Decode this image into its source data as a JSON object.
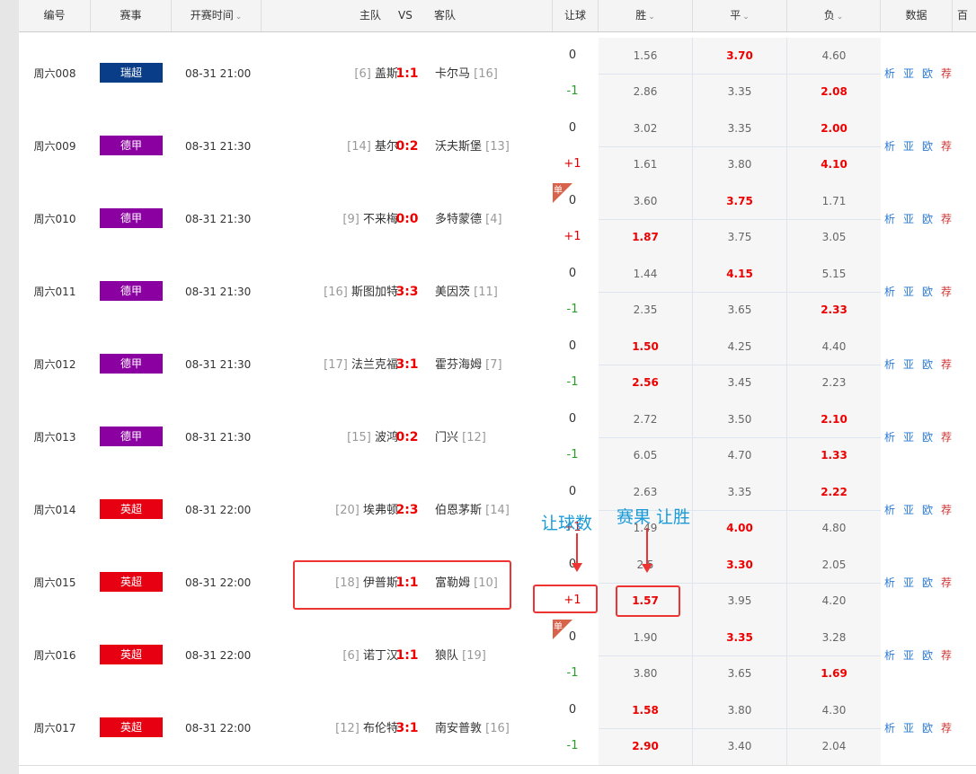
{
  "headers": {
    "num": "编号",
    "league": "赛事",
    "time": "开赛时间",
    "home": "主队",
    "vs": "VS",
    "away": "客队",
    "handicap": "让球",
    "win": "胜",
    "draw": "平",
    "lose": "负",
    "data": "数据",
    "extra": "百"
  },
  "colors": {
    "league_瑞超": "#0a3d87",
    "league_德甲": "#8b00a0",
    "league_英超": "#e60012",
    "red_text": "#e00000",
    "annotation": "#e33333",
    "annotation_text": "#1a9bd8"
  },
  "link_labels": [
    "析",
    "亚",
    "欧",
    "荐"
  ],
  "matches": [
    {
      "num": "周六008",
      "league": "瑞超",
      "league_color": "#0a3d87",
      "time": "08-31 21:00",
      "home_rank": "[6]",
      "home": "盖斯",
      "score": "1:1",
      "away": "卡尔马",
      "away_rank": "[16]",
      "hcp1": "0",
      "hcp2": "-1",
      "hcp2_color": "#2a9d2a",
      "dan": false,
      "odds1": [
        "1.56",
        "3.70",
        "4.60"
      ],
      "odds2": [
        "2.86",
        "3.35",
        "2.08"
      ],
      "red1": [
        false,
        true,
        false
      ],
      "red2": [
        false,
        false,
        true
      ]
    },
    {
      "num": "周六009",
      "league": "德甲",
      "league_color": "#8b00a0",
      "time": "08-31 21:30",
      "home_rank": "[14]",
      "home": "基尔",
      "score": "0:2",
      "away": "沃夫斯堡",
      "away_rank": "[13]",
      "hcp1": "0",
      "hcp2": "+1",
      "hcp2_color": "#e00000",
      "dan": false,
      "odds1": [
        "3.02",
        "3.35",
        "2.00"
      ],
      "odds2": [
        "1.61",
        "3.80",
        "4.10"
      ],
      "red1": [
        false,
        false,
        true
      ],
      "red2": [
        false,
        false,
        true
      ]
    },
    {
      "num": "周六010",
      "league": "德甲",
      "league_color": "#8b00a0",
      "time": "08-31 21:30",
      "home_rank": "[9]",
      "home": "不来梅",
      "score": "0:0",
      "away": "多特蒙德",
      "away_rank": "[4]",
      "hcp1": "0",
      "hcp2": "+1",
      "hcp2_color": "#e00000",
      "dan": true,
      "odds1": [
        "3.60",
        "3.75",
        "1.71"
      ],
      "odds2": [
        "1.87",
        "3.75",
        "3.05"
      ],
      "red1": [
        false,
        true,
        false
      ],
      "red2": [
        true,
        false,
        false
      ]
    },
    {
      "num": "周六011",
      "league": "德甲",
      "league_color": "#8b00a0",
      "time": "08-31 21:30",
      "home_rank": "[16]",
      "home": "斯图加特",
      "score": "3:3",
      "away": "美因茨",
      "away_rank": "[11]",
      "hcp1": "0",
      "hcp2": "-1",
      "hcp2_color": "#2a9d2a",
      "dan": false,
      "odds1": [
        "1.44",
        "4.15",
        "5.15"
      ],
      "odds2": [
        "2.35",
        "3.65",
        "2.33"
      ],
      "red1": [
        false,
        true,
        false
      ],
      "red2": [
        false,
        false,
        true
      ]
    },
    {
      "num": "周六012",
      "league": "德甲",
      "league_color": "#8b00a0",
      "time": "08-31 21:30",
      "home_rank": "[17]",
      "home": "法兰克福",
      "score": "3:1",
      "away": "霍芬海姆",
      "away_rank": "[7]",
      "hcp1": "0",
      "hcp2": "-1",
      "hcp2_color": "#2a9d2a",
      "dan": false,
      "odds1": [
        "1.50",
        "4.25",
        "4.40"
      ],
      "odds2": [
        "2.56",
        "3.45",
        "2.23"
      ],
      "red1": [
        true,
        false,
        false
      ],
      "red2": [
        true,
        false,
        false
      ]
    },
    {
      "num": "周六013",
      "league": "德甲",
      "league_color": "#8b00a0",
      "time": "08-31 21:30",
      "home_rank": "[15]",
      "home": "波鸿",
      "score": "0:2",
      "away": "门兴",
      "away_rank": "[12]",
      "hcp1": "0",
      "hcp2": "-1",
      "hcp2_color": "#2a9d2a",
      "dan": false,
      "odds1": [
        "2.72",
        "3.50",
        "2.10"
      ],
      "odds2": [
        "6.05",
        "4.70",
        "1.33"
      ],
      "red1": [
        false,
        false,
        true
      ],
      "red2": [
        false,
        false,
        true
      ]
    },
    {
      "num": "周六014",
      "league": "英超",
      "league_color": "#e60012",
      "time": "08-31 22:00",
      "home_rank": "[20]",
      "home": "埃弗顿",
      "score": "2:3",
      "away": "伯恩茅斯",
      "away_rank": "[14]",
      "hcp1": "0",
      "hcp2": "+1",
      "hcp2_color": "#e00000",
      "dan": false,
      "odds1": [
        "2.63",
        "3.35",
        "2.22"
      ],
      "odds2": [
        "1.49",
        "4.00",
        "4.80"
      ],
      "red1": [
        false,
        false,
        true
      ],
      "red2": [
        false,
        true,
        false
      ]
    },
    {
      "num": "周六015",
      "league": "英超",
      "league_color": "#e60012",
      "time": "08-31 22:00",
      "home_rank": "[18]",
      "home": "伊普斯",
      "score": "1:1",
      "away": "富勒姆",
      "away_rank": "[10]",
      "hcp1": "0",
      "hcp2": "+1",
      "hcp2_color": "#e00000",
      "dan": false,
      "odds1": [
        "2.5",
        "3.30",
        "2.05"
      ],
      "odds2": [
        "1.57",
        "3.95",
        "4.20"
      ],
      "red1": [
        false,
        true,
        false
      ],
      "red2": [
        true,
        false,
        false
      ]
    },
    {
      "num": "周六016",
      "league": "英超",
      "league_color": "#e60012",
      "time": "08-31 22:00",
      "home_rank": "[6]",
      "home": "诺丁汉",
      "score": "1:1",
      "away": "狼队",
      "away_rank": "[19]",
      "hcp1": "0",
      "hcp2": "-1",
      "hcp2_color": "#2a9d2a",
      "dan": true,
      "odds1": [
        "1.90",
        "3.35",
        "3.28"
      ],
      "odds2": [
        "3.80",
        "3.65",
        "1.69"
      ],
      "red1": [
        false,
        true,
        false
      ],
      "red2": [
        false,
        false,
        true
      ]
    },
    {
      "num": "周六017",
      "league": "英超",
      "league_color": "#e60012",
      "time": "08-31 22:00",
      "home_rank": "[12]",
      "home": "布伦特",
      "score": "3:1",
      "away": "南安普敦",
      "away_rank": "[16]",
      "hcp1": "0",
      "hcp2": "-1",
      "hcp2_color": "#2a9d2a",
      "dan": false,
      "odds1": [
        "1.58",
        "3.80",
        "4.30"
      ],
      "odds2": [
        "2.90",
        "3.40",
        "2.04"
      ],
      "red1": [
        true,
        false,
        false
      ],
      "red2": [
        true,
        false,
        false
      ]
    }
  ],
  "dan_label": "单",
  "annotations": {
    "handicap_label": "让球数",
    "result_label": "赛果 让胜"
  }
}
